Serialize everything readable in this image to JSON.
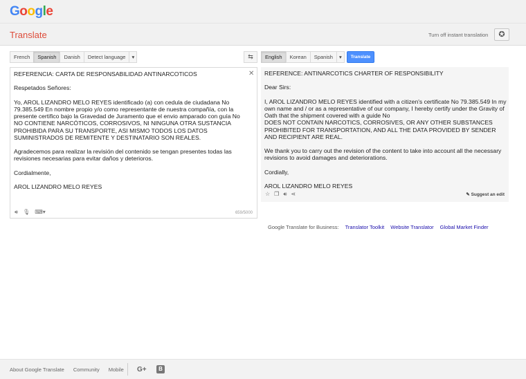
{
  "logo": {
    "letters": [
      {
        "ch": "G",
        "color": "#4285f4"
      },
      {
        "ch": "o",
        "color": "#ea4335"
      },
      {
        "ch": "o",
        "color": "#fbbc05"
      },
      {
        "ch": "g",
        "color": "#4285f4"
      },
      {
        "ch": "l",
        "color": "#34a853"
      },
      {
        "ch": "e",
        "color": "#ea4335"
      }
    ]
  },
  "header": {
    "title": "Translate",
    "instant_link": "Turn off instant translation"
  },
  "source": {
    "languages": [
      "French",
      "Spanish",
      "Danish",
      "Detect language"
    ],
    "active_language": "Spanish",
    "text": "REFERENCIA: CARTA DE RESPONSABILIDAD ANTINARCOTICOS\n\nRespetados Señores:\n\nYo, AROL LIZANDRO MELO REYES identificado (a) con cedula de ciudadana No 79.385.549 En nombre propio y/o como representante de nuestra compañía, con la presente certifico bajo la Gravedad de Juramento que el envio amparado con guía No\nNO CONTIENE NARCÓTICOS, CORROSIVOS, NI NINGUNA OTRA SUSTANCIA PROHIBIDA PARA SU TRANSPORTE, ASI MISMO TODOS LOS DATOS SUMINISTRADOS DE REMITENTE Y DESTINATARIO SON REALES.\n\nAgradecemos para realizar la revisión del contenido se tengan presentes todas las revisiones necesarias para evitar daños y deterioros.\n\nCordialmente,\n\nAROL LIZANDRO MELO REYES",
    "char_count": "659/5000"
  },
  "target": {
    "languages": [
      "English",
      "Korean",
      "Spanish"
    ],
    "active_language": "English",
    "translate_label": "Translate",
    "text": "REFERENCE: ANTINARCOTICS CHARTER OF RESPONSIBILITY\n\nDear Sirs:\n\nI, AROL LIZANDRO MELO REYES identified with a citizen's certificate No 79.385.549 In my own name and / or as a representative of our company, I hereby certify under the Gravity of Oath that the shipment covered with a guide No\nDOES NOT CONTAIN NARCOTICS, CORROSIVES, OR ANY OTHER SUBSTANCES PROHIBITED FOR TRANSPORTATION, AND ALL THE DATA PROVIDED BY SENDER AND RECIPIENT ARE REAL.\n\nWe thank you to carry out the revision of the content to take into account all the necessary revisions to avoid damages and deteriorations.\n\nCordially,\n\nAROL LIZANDRO MELO REYES",
    "suggest_label": "Suggest an edit"
  },
  "business": {
    "label": "Google Translate for Business:",
    "links": [
      "Translator Toolkit",
      "Website Translator",
      "Global Market Finder"
    ]
  },
  "footer": {
    "links": [
      "About Google Translate",
      "Community",
      "Mobile"
    ]
  }
}
